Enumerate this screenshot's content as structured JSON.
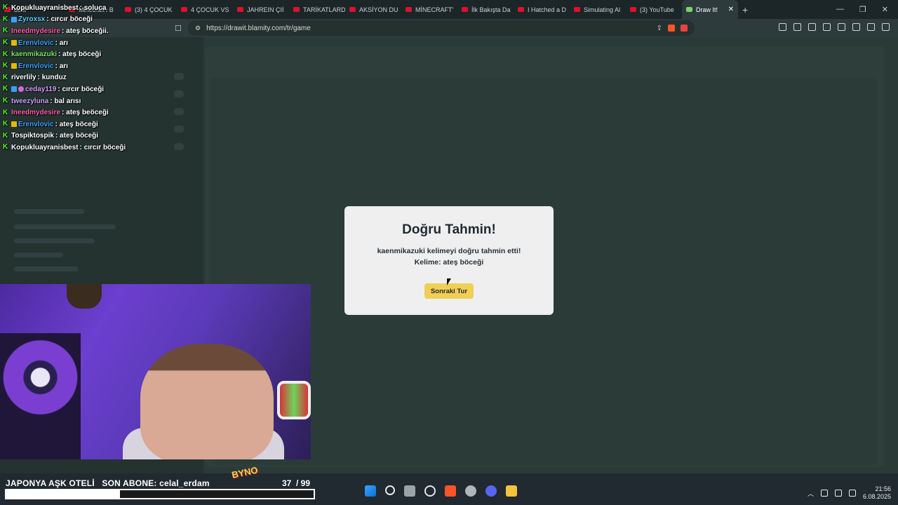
{
  "browser": {
    "tabs": [
      {
        "label": "dest"
      },
      {
        "label": "Minecraft'ı B"
      },
      {
        "label": "(3) 4 ÇOCUK"
      },
      {
        "label": "4 ÇOCUK VS"
      },
      {
        "label": "JAHREIN ÇIİ"
      },
      {
        "label": "TARİKATLARD"
      },
      {
        "label": "AKSİYON DU"
      },
      {
        "label": "MİNECRAFT'"
      },
      {
        "label": "İlk Bakışta Da"
      },
      {
        "label": "I Hatched a D"
      },
      {
        "label": "Simulating Al"
      },
      {
        "label": "(3) YouTube"
      },
      {
        "label": "Draw It!"
      }
    ],
    "url": "https://drawit.blamity.com/tr/game",
    "colors": {
      "youtube": "#e0112b",
      "active_tab": "#2d3b3c"
    }
  },
  "chat": {
    "messages": [
      {
        "user": "Kopukluayranisbest",
        "text": ": soluca",
        "color": "#ffffff",
        "badges": [
          "k"
        ]
      },
      {
        "user": "Zyroxsx",
        "text": ": cırcır böceği",
        "color": "#5bd1ff",
        "badges": [
          "k",
          "blue"
        ]
      },
      {
        "user": "Ineedmydesire",
        "text": ": ateş böceğii.",
        "color": "#ff5ca8",
        "badges": [
          "k"
        ]
      },
      {
        "user": "Erenvlovic",
        "text": ": arı",
        "color": "#3aa0ff",
        "badges": [
          "k",
          "crown"
        ]
      },
      {
        "user": "kaenmikazuki",
        "text": ": ateş böceği",
        "color": "#7fe36b",
        "badges": [
          "k"
        ]
      },
      {
        "user": "Erenvlovic",
        "text": ": arı",
        "color": "#3aa0ff",
        "badges": [
          "k",
          "crown"
        ]
      },
      {
        "user": "riverlily",
        "text": ": kunduz",
        "color": "#ffffff",
        "badges": [
          "k"
        ]
      },
      {
        "user": "ceday119",
        "text": ": cırcır böceği",
        "color": "#d89bff",
        "badges": [
          "k",
          "blue",
          "pink"
        ]
      },
      {
        "user": "tweezyluna",
        "text": ": bal arısı",
        "color": "#c8a2ff",
        "badges": [
          "k"
        ]
      },
      {
        "user": "Ineedmydesire",
        "text": ": ateş beöceği",
        "color": "#ff5ca8",
        "badges": [
          "k"
        ]
      },
      {
        "user": "Erenvlovic",
        "text": ": ateş böceği",
        "color": "#3aa0ff",
        "badges": [
          "k",
          "crown"
        ]
      },
      {
        "user": "Tospiktospik",
        "text": ": ateş böceği",
        "color": "#ffffff",
        "badges": [
          "k"
        ]
      },
      {
        "user": "Kopukluayranisbest",
        "text": ": cırcır böceği",
        "color": "#ffffff",
        "badges": [
          "k"
        ]
      }
    ]
  },
  "modal": {
    "title": "Doğru Tahmin!",
    "text": "kaenmikazuki kelimeyi doğru tahmin etti! Kelime: ateş böceği",
    "button": "Sonraki Tur",
    "button_color": "#f0cf56"
  },
  "stream": {
    "ticker": "JAPONYA AŞK OTELİ   SON ABONE: celal_erdam",
    "count": "37  / 99",
    "progress": 0.37,
    "logo": "BYNO"
  },
  "system": {
    "time": "21:56",
    "date": "6.08.2025"
  }
}
